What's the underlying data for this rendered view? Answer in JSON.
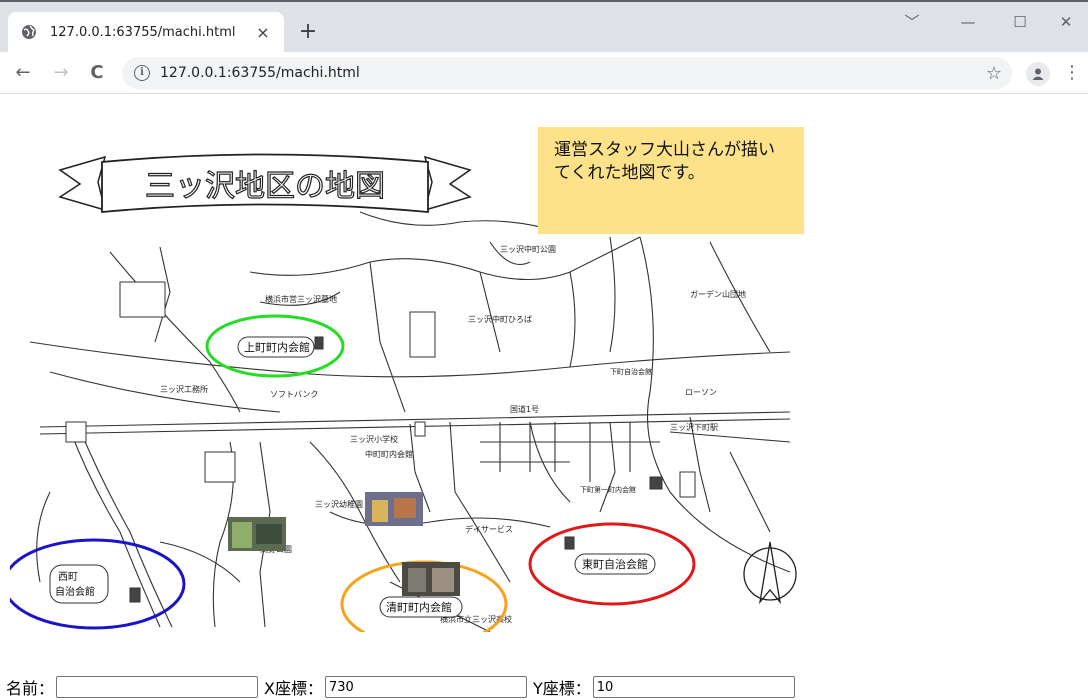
{
  "browser": {
    "tab_title": "127.0.0.1:63755/machi.html",
    "tab_close": "×",
    "new_tab": "+",
    "url": "127.0.0.1:63755/machi.html",
    "win_chevron": "﹀",
    "win_min": "—",
    "win_max": "☐",
    "win_close": "✕",
    "back": "←",
    "forward": "→",
    "reload": "C",
    "star": "☆",
    "menu": "⋮",
    "info": "i"
  },
  "map": {
    "banner_title": "三ッ沢地区の地図",
    "note": "運営スタッフ大山さんが描いてくれた地図です。",
    "highlights": {
      "green": "上町町内会館",
      "blue": "西町自治会館",
      "orange": "清町町内会館",
      "red": "東町自治会館"
    },
    "colors": {
      "green": "#22dd22",
      "blue": "#1a14c8",
      "orange": "#f5a31a",
      "red": "#e01818",
      "note_bg": "#fde28a"
    },
    "labels": [
      "横浜市営三ッ沢墓地",
      "ガーデン山団地",
      "三ッ沢中町公園",
      "三ッ沢中町ひろば",
      "下町自治会館",
      "ローソン",
      "三ッ沢小学校",
      "中町町内会館",
      "下町第一町内会館",
      "三ッ沢幼稚園",
      "岡野公園",
      "ソフトバンク",
      "三ッ沢工務所",
      "三ッ沢下町駅",
      "デイサービス",
      "横浜市立三ッ沢高校",
      "国道1号"
    ]
  },
  "form": {
    "name_label": "名前：",
    "name_value": "",
    "x_label": "X座標：",
    "x_value": "730",
    "y_label": "Y座標：",
    "y_value": "10"
  }
}
